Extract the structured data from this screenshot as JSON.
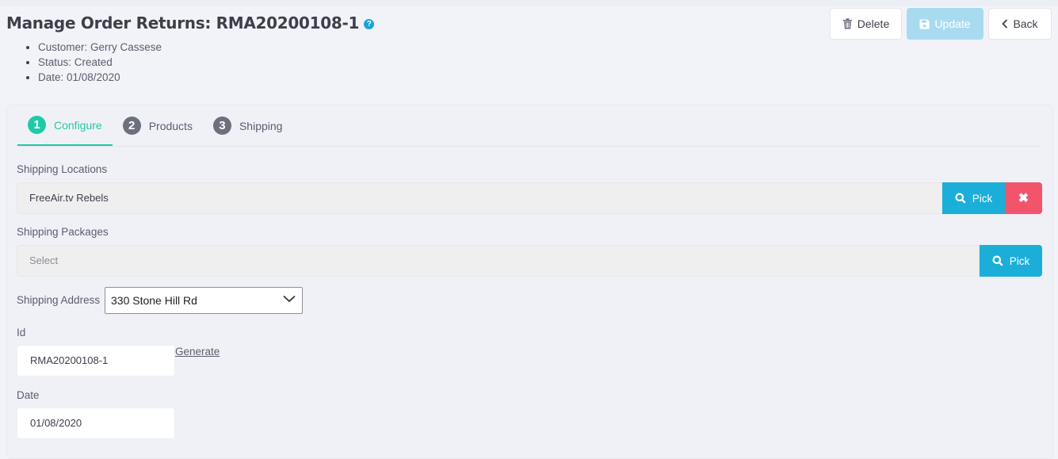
{
  "header": {
    "title": "Manage Order Returns: RMA20200108-1",
    "help_glyph": "?",
    "meta": [
      "Customer: Gerry Cassese",
      "Status: Created",
      "Date: 01/08/2020"
    ]
  },
  "actions": {
    "delete_label": "Delete",
    "update_label": "Update",
    "back_label": "Back"
  },
  "tabs": [
    {
      "num": "1",
      "label": "Configure",
      "active": true
    },
    {
      "num": "2",
      "label": "Products"
    },
    {
      "num": "3",
      "label": "Shipping"
    }
  ],
  "form": {
    "shipping_locations": {
      "label": "Shipping Locations",
      "value": "FreeAir.tv Rebels",
      "pick_label": "Pick",
      "clear_glyph": "✖"
    },
    "shipping_packages": {
      "label": "Shipping Packages",
      "placeholder": "Select",
      "pick_label": "Pick"
    },
    "shipping_address": {
      "label": "Shipping Address",
      "selected": "330 Stone Hill Rd"
    },
    "id": {
      "label": "Id",
      "value": "RMA20200108-1",
      "generate_label": "Generate"
    },
    "date": {
      "label": "Date",
      "value": "01/08/2020"
    }
  },
  "colors": {
    "accent": "#20c9a6",
    "info": "#1aaed9",
    "danger": "#f2546b",
    "update_disabled": "#a9dbf0"
  }
}
